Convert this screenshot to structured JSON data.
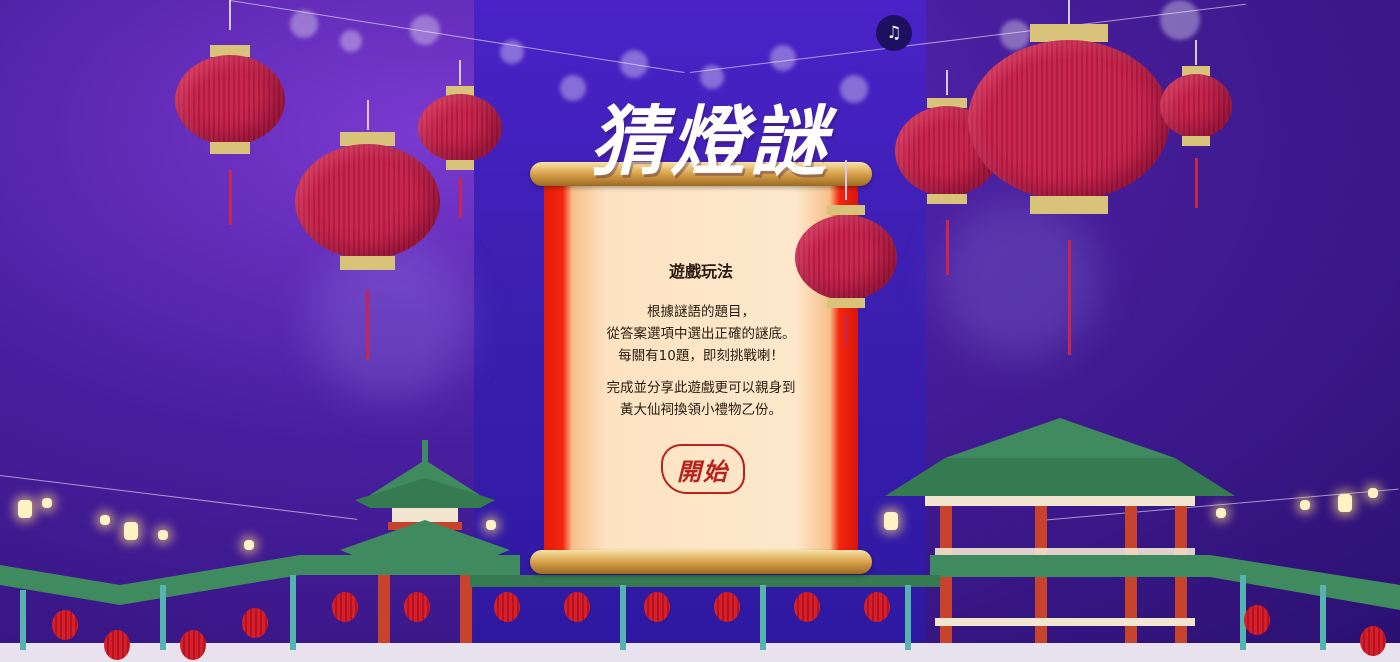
{
  "title": "猜燈謎",
  "music_button": {
    "icon": "music-note-icon",
    "glyph": "♫"
  },
  "scroll": {
    "heading": "遊戲玩法",
    "rules_paragraph_1": [
      "根據謎語的題目，",
      "從答案選項中選出正確的謎底。",
      "每關有10題，即刻挑戰喇！"
    ],
    "rules_paragraph_2": [
      "完成並分享此遊戲更可以親身到",
      "黃大仙祠換領小禮物乙份。"
    ],
    "start_label": "開始"
  },
  "colors": {
    "background": "#4a1fa0",
    "panel": "#3b1fb0",
    "lantern_red": "#c9264e",
    "scroll_red": "#e11b0c",
    "paper": "#fde3c2",
    "seal_red": "#b8231b",
    "pavilion_roof": "#3f8a5e",
    "pavilion_pillar": "#c8432c"
  }
}
